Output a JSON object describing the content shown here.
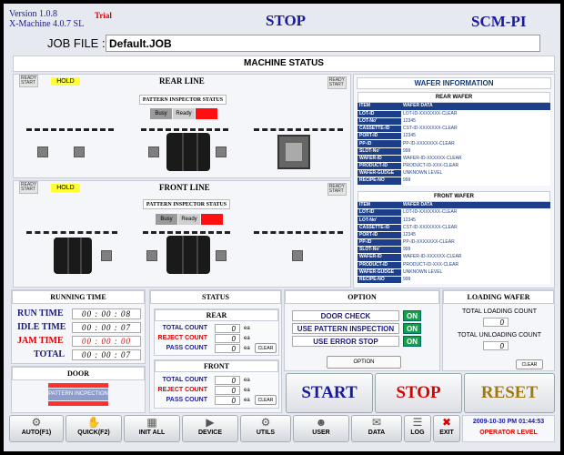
{
  "header": {
    "version": "Version 1.0.8",
    "xmachine": "X-Machine 4.0.7 SL",
    "trial": "Trial",
    "state": "STOP",
    "brand": "SCM-PI"
  },
  "job": {
    "label": "JOB FILE :",
    "value": "Default.JOB"
  },
  "machine_status": {
    "title": "MACHINE STATUS",
    "rear": {
      "name": "REAR LINE",
      "ready": "READY",
      "start": "START",
      "hold": "HOLD",
      "pis_title": "PATTERN INSPECTOR STATUS",
      "busy": "Busy",
      "ready_ind": "Ready",
      "red_ind": "Ready"
    },
    "front": {
      "name": "FRONT LINE",
      "ready": "READY",
      "start": "START",
      "hold": "HOLD",
      "pis_title": "PATTERN INSPECTOR STATUS",
      "busy": "Busy",
      "ready_ind": "Ready",
      "red_ind": "Ready"
    }
  },
  "wafer_info": {
    "title": "WAFER INFORMATION",
    "rear_title": "REAR WAFER",
    "front_title": "FRONT WAFER",
    "col_item": "ITEM",
    "col_data": "WAFER DATA",
    "rear_rows": [
      {
        "k": "LOT-ID",
        "v": "LOT-ID-XXXXXXX-CLEAR"
      },
      {
        "k": "LOT-No'",
        "v": "12345"
      },
      {
        "k": "CASSETTE-ID",
        "v": "CST-ID-XXXXXXX-CLEAR"
      },
      {
        "k": "PORT-ID",
        "v": "12345"
      },
      {
        "k": "PP-ID",
        "v": "PP-ID-XXXXXXX-CLEAR"
      },
      {
        "k": "SLOT-No'",
        "v": "999"
      },
      {
        "k": "WAFER-ID",
        "v": "WAFER-ID-XXXXXX-CLEAR"
      },
      {
        "k": "PRODUCT-ID",
        "v": "PRODUCT-ID-XXX-CLEAR"
      },
      {
        "k": "WAFER-GUDGE",
        "v": "UNKNOWN LEVEL"
      },
      {
        "k": "RECIPE-NO",
        "v": "999"
      }
    ],
    "front_rows": [
      {
        "k": "LOT-ID",
        "v": "LOT-ID-XXXXXXX-CLEAR"
      },
      {
        "k": "LOT-No'",
        "v": "12345"
      },
      {
        "k": "CASSETTE-ID",
        "v": "CST-ID-XXXXXXX-CLEAR"
      },
      {
        "k": "PORT-ID",
        "v": "12345"
      },
      {
        "k": "PP-ID",
        "v": "PP-ID-XXXXXXX-CLEAR"
      },
      {
        "k": "SLOT-No'",
        "v": "999"
      },
      {
        "k": "WAFER-ID",
        "v": "WAFER-ID-XXXXXX-CLEAR"
      },
      {
        "k": "PRODUCT-ID",
        "v": "PRODUCT-ID-XXX-CLEAR"
      },
      {
        "k": "WAFER-GUDGE",
        "v": "UNKNOWN LEVEL"
      },
      {
        "k": "RECIPE-NO",
        "v": "999"
      }
    ]
  },
  "running_time": {
    "title": "RUNNING TIME",
    "run_label": "RUN TIME",
    "run_value": "00 : 00 : 08",
    "idle_label": "IDLE TIME",
    "idle_value": "00 : 00 : 07",
    "jam_label": "JAM TIME",
    "jam_value": "00 : 00 : 00",
    "total_label": "TOTAL",
    "total_value": "00 : 00 : 07"
  },
  "door": {
    "title": "DOOR",
    "button": "PATTERN INCPECTION"
  },
  "status": {
    "title": "STATUS",
    "rear": {
      "title": "REAR",
      "total_label": "TOTAL COUNT",
      "total": "0",
      "reject_label": "REJECT COUNT",
      "reject": "0",
      "pass_label": "PASS COUNT",
      "pass": "0",
      "unit": "ea",
      "clear": "CLEAR"
    },
    "front": {
      "title": "FRONT",
      "total_label": "TOTAL COUNT",
      "total": "0",
      "reject_label": "REJECT COUNT",
      "reject": "0",
      "pass_label": "PASS COUNT",
      "pass": "0",
      "unit": "ea",
      "clear": "CLEAR"
    }
  },
  "option": {
    "title": "OPTION",
    "door_check": "DOOR CHECK",
    "door_check_state": "ON",
    "use_pi": "USE PATTERN INSPECTION",
    "use_pi_state": "ON",
    "use_err": "USE ERROR STOP",
    "use_err_state": "ON",
    "button": "OPTION"
  },
  "loading": {
    "title": "LOADING WAFER",
    "total_loading_label": "TOTAL LOADING COUNT",
    "total_loading": "0",
    "total_unloading_label": "TOTAL UNLOADING COUNT",
    "total_unloading": "0",
    "clear": "CLEAR"
  },
  "controls": {
    "start": "START",
    "stop": "STOP",
    "reset": "RESET"
  },
  "toolbar": {
    "auto": "AUTO(F1)",
    "quick": "QUICK(F2)",
    "init": "INIT ALL",
    "device": "DEVICE",
    "utils": "UTILS",
    "user": "USER",
    "data": "DATA",
    "log": "LOG",
    "exit": "EXIT"
  },
  "statusbar": {
    "datetime": "2009-10-30 PM 01:44:53",
    "level": "OPERATOR LEVEL"
  },
  "colors": {
    "accent": "#1a1a9c",
    "danger": "#dd0000",
    "on": "#0ea14a",
    "hold": "#ffff33"
  }
}
